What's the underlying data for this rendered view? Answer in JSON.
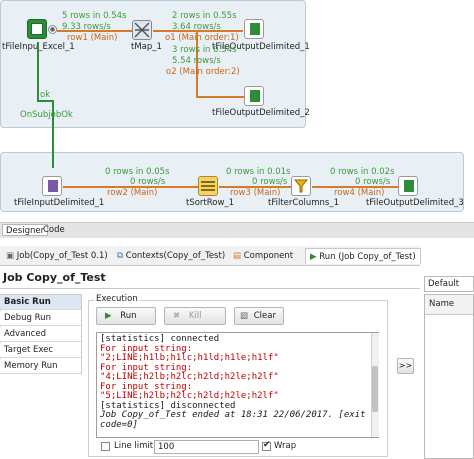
{
  "canvas": {
    "top_flow": {
      "tfileinput_excel": "tFileInpu_Excel_1",
      "tmap": "tMap_1",
      "toutput1": "tFileOutputDelimited_1",
      "toutput2": "tFileOutputDelimited_2",
      "stats_row1": "5 rows in 0.54s",
      "rate_row1": "9.33 rows/s",
      "label_row1": "row1 (Main)",
      "stats_o1": "2 rows in 0.55s",
      "rate_o1": "3.64 rows/s",
      "label_o1": "o1 (Main order:1)",
      "stats_o2": "3 rows in 0.54s",
      "rate_o2": "5.54 rows/s",
      "label_o2": "o2 (Main order:2)"
    },
    "ok_label": "ok",
    "onsubjob_label": "OnSubjobOk",
    "bottom_flow": {
      "tinput": "tFileInputDelimited_1",
      "tsortrow": "tSortRow_1",
      "tfilter": "tFilterColumns_1",
      "toutput3": "tFileOutputDelimited_3",
      "stats_row2": "0 rows in 0.05s",
      "rate_row2": "0 rows/s",
      "label_row2": "row2 (Main)",
      "stats_row3": "0 rows in 0.01s",
      "rate_row3": "0 rows/s",
      "label_row3": "row3 (Main)",
      "stats_row4": "0 rows in 0.02s",
      "rate_row4": "0 rows/s",
      "label_row4": "row4 (Main)"
    }
  },
  "editor_tabs": [
    "Designer",
    "Code"
  ],
  "view_tabs": {
    "job": "Job(Copy_of_Test 0.1)",
    "contexts": "Contexts(Copy_of_Test)",
    "component": "Component",
    "run": "Run (Job Copy_of_Test)"
  },
  "job_title": "Job Copy_of_Test",
  "sidebar": [
    "Basic Run",
    "Debug Run",
    "Advanced settings",
    "Target Exec",
    "Memory Run"
  ],
  "execution": {
    "group_label": "Execution",
    "run_label": "Run",
    "kill_label": "Kill",
    "clear_label": "Clear"
  },
  "console_lines": [
    {
      "text": "[statistics] connected",
      "color": "#1a1a1a"
    },
    {
      "text": "For input string:",
      "color": "#c00000"
    },
    {
      "text": "\"2;LINE;h1lb;h1lc;h1ld;h1le;h1lf\"",
      "color": "#c00000"
    },
    {
      "text": "For input string:",
      "color": "#c00000"
    },
    {
      "text": "\"4;LINE;h2lb;h2lc;h2ld;h2le;h2lf\"",
      "color": "#c00000"
    },
    {
      "text": "For input string:",
      "color": "#c00000"
    },
    {
      "text": "\"5;LINE;h2lb;h2lc;h2ld;h2le;h2lf\"",
      "color": "#c00000"
    },
    {
      "text": "[statistics] disconnected",
      "color": "#1a1a1a"
    },
    {
      "text": "Job Copy_of_Test ended at 18:31 22/06/2017. [exit",
      "color": "#1a1a1a"
    },
    {
      "text": "code=0]",
      "color": "#1a1a1a"
    }
  ],
  "move_button": ">>",
  "line_limit": {
    "label": "Line limit",
    "value": "100",
    "checked": false
  },
  "wrap": {
    "label": "Wrap",
    "checked": true
  },
  "context": {
    "selected": "Default",
    "column_name": "Name"
  },
  "colors": {
    "accent_orange": "#d77a2a",
    "stats_green": "#3b9a3b",
    "error_red": "#c00000"
  }
}
